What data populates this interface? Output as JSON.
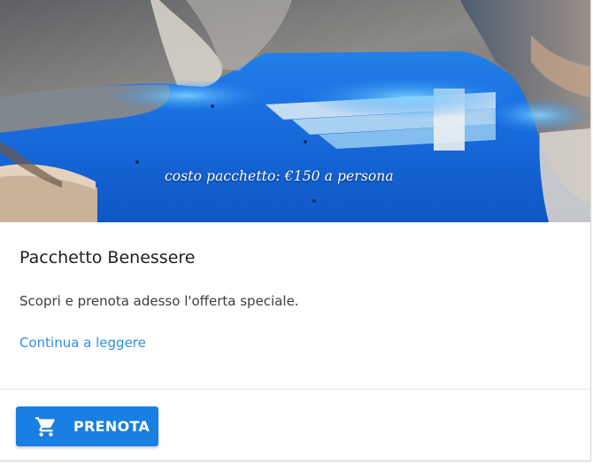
{
  "hero": {
    "image_alt": "Indoor cave spa pool with blue lighting",
    "caption": "costo pacchetto: €150 a persona"
  },
  "card": {
    "title": "Pacchetto Benessere",
    "description": "Scopri e prenota adesso l'offerta speciale.",
    "read_more_label": "Continua a leggere"
  },
  "actions": {
    "book_label": "PRENOTA",
    "book_icon": "cart-icon"
  },
  "colors": {
    "accent": "#1a7fe2",
    "link": "#2f8fe8",
    "title": "#1e1e1e",
    "text": "#3d3d3d"
  }
}
